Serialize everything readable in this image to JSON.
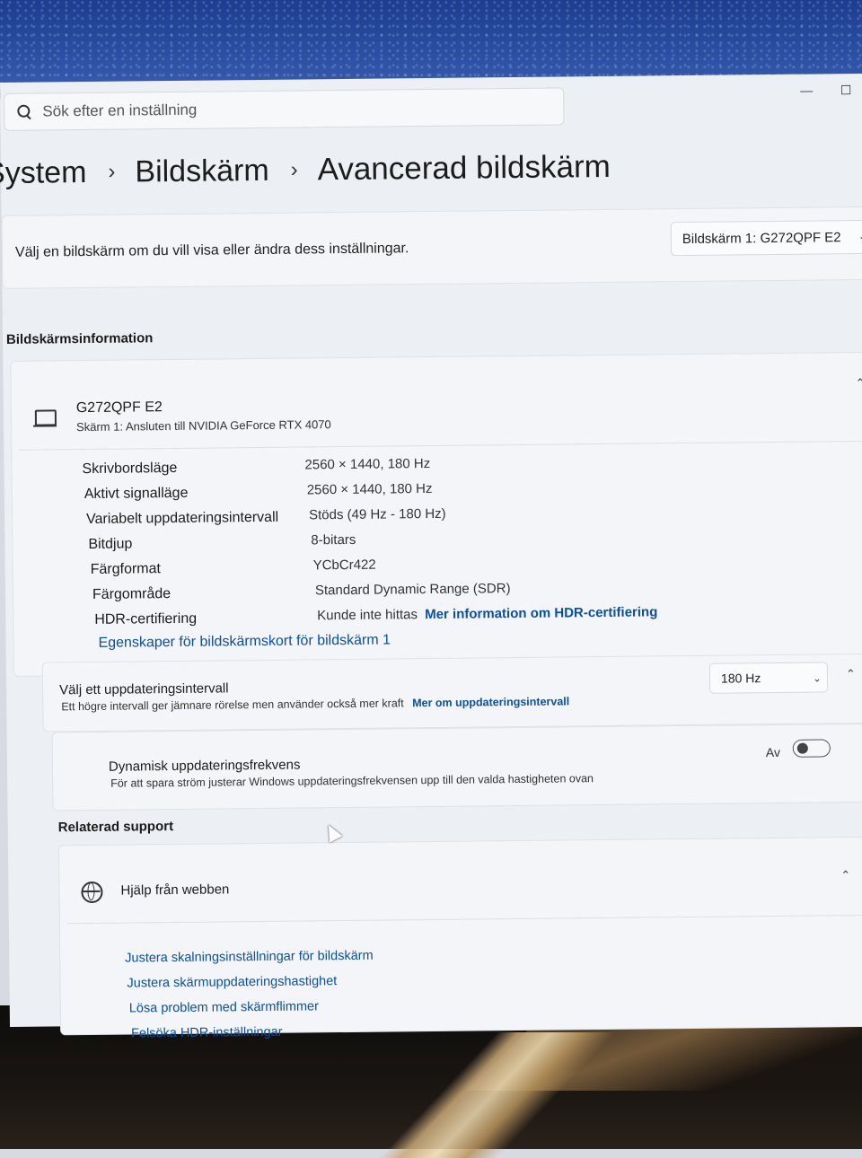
{
  "window": {
    "minimize_glyph": "—",
    "maximize_glyph": "☐"
  },
  "search": {
    "placeholder": "Sök efter en inställning"
  },
  "breadcrumb": {
    "items": [
      "System",
      "Bildskärm",
      "Avancerad bildskärm"
    ],
    "separator": "›"
  },
  "display_select": {
    "prompt": "Välj en bildskärm om du vill visa eller ändra dess inställningar.",
    "selected": "Bildskärm 1: G272QPF E2"
  },
  "display_info": {
    "section_title": "Bildskärmsinformation",
    "monitor_name": "G272QPF E2",
    "monitor_sub": "Skärm 1: Ansluten till NVIDIA GeForce RTX 4070",
    "properties": [
      {
        "label": "Skrivbordsläge",
        "value": "2560 × 1440, 180 Hz"
      },
      {
        "label": "Aktivt signalläge",
        "value": "2560 × 1440, 180 Hz"
      },
      {
        "label": "Variabelt uppdateringsintervall",
        "value": "Stöds (49 Hz - 180 Hz)"
      },
      {
        "label": "Bitdjup",
        "value": "8-bitars"
      },
      {
        "label": "Färgformat",
        "value": "YCbCr422"
      },
      {
        "label": "Färgområde",
        "value": "Standard Dynamic Range (SDR)"
      },
      {
        "label": "HDR-certifiering",
        "value": "Kunde inte hittas",
        "link": "Mer information om HDR-certifiering"
      }
    ],
    "adapter_link": "Egenskaper för bildskärmskort för bildskärm 1"
  },
  "refresh": {
    "title": "Välj ett uppdateringsintervall",
    "description": "Ett högre intervall ger jämnare rörelse men använder också mer kraft",
    "link": "Mer om uppdateringsintervall",
    "selected": "180 Hz"
  },
  "dynamic_refresh": {
    "title": "Dynamisk uppdateringsfrekvens",
    "description": "För att spara ström justerar Windows uppdateringsfrekvensen upp till den valda hastigheten ovan",
    "state": "Av"
  },
  "support": {
    "section_title": "Relaterad support",
    "help_label": "Hjälp från webben",
    "links": [
      "Justera skalningsinställningar för bildskärm",
      "Justera skärmuppdateringshastighet",
      "Lösa problem med skärmflimmer",
      "Felsöka HDR-inställningar"
    ]
  },
  "glyphs": {
    "chevron_down": "⌄",
    "chevron_up": "⌃"
  }
}
